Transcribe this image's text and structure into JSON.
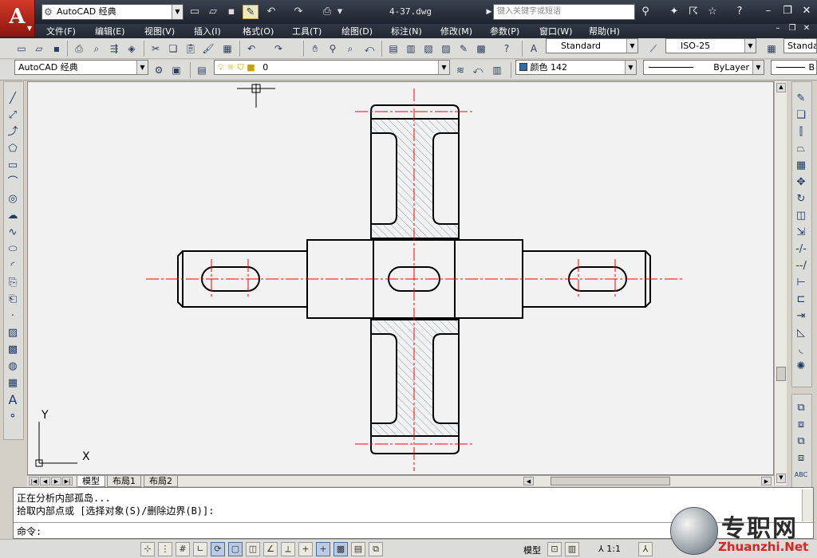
{
  "titlebar": {
    "app_button_letter": "A",
    "workspace": "AutoCAD 经典",
    "doc_title": "4-37.dwg",
    "search_placeholder": "键入关键字或短语",
    "colors": {
      "titlebar_bg": "#262c37",
      "app_button": "#c0281a"
    }
  },
  "menubar": {
    "items": [
      "文件(F)",
      "编辑(E)",
      "视图(V)",
      "插入(I)",
      "格式(O)",
      "工具(T)",
      "绘图(D)",
      "标注(N)",
      "修改(M)",
      "参数(P)",
      "窗口(W)",
      "帮助(H)"
    ]
  },
  "toolbar1": {
    "text_style": "Standard",
    "dim_style": "ISO-25",
    "table_style": "Standa"
  },
  "toolbar2": {
    "workspace": "AutoCAD 经典",
    "layer": "0",
    "color": "颜色 142",
    "linetype": "ByLayer",
    "lineweight": "B"
  },
  "canvas": {
    "ucs_x": "X",
    "ucs_y": "Y",
    "colors": {
      "geometry": "#000000",
      "centerline": "#ff0000",
      "hatch": "#5f86b5"
    }
  },
  "layout_tabs": [
    "模型",
    "布局1",
    "布局2"
  ],
  "command": {
    "line1": "正在分析内部孤岛...",
    "line2": "拾取内部点或 [选择对象(S)/删除边界(B)]:",
    "prompt": "命令:"
  },
  "statusbar": {
    "model_label": "模型",
    "scale": "1:1"
  },
  "watermark": {
    "cn": "专职网",
    "en": "Zhuanzhi.Net"
  }
}
